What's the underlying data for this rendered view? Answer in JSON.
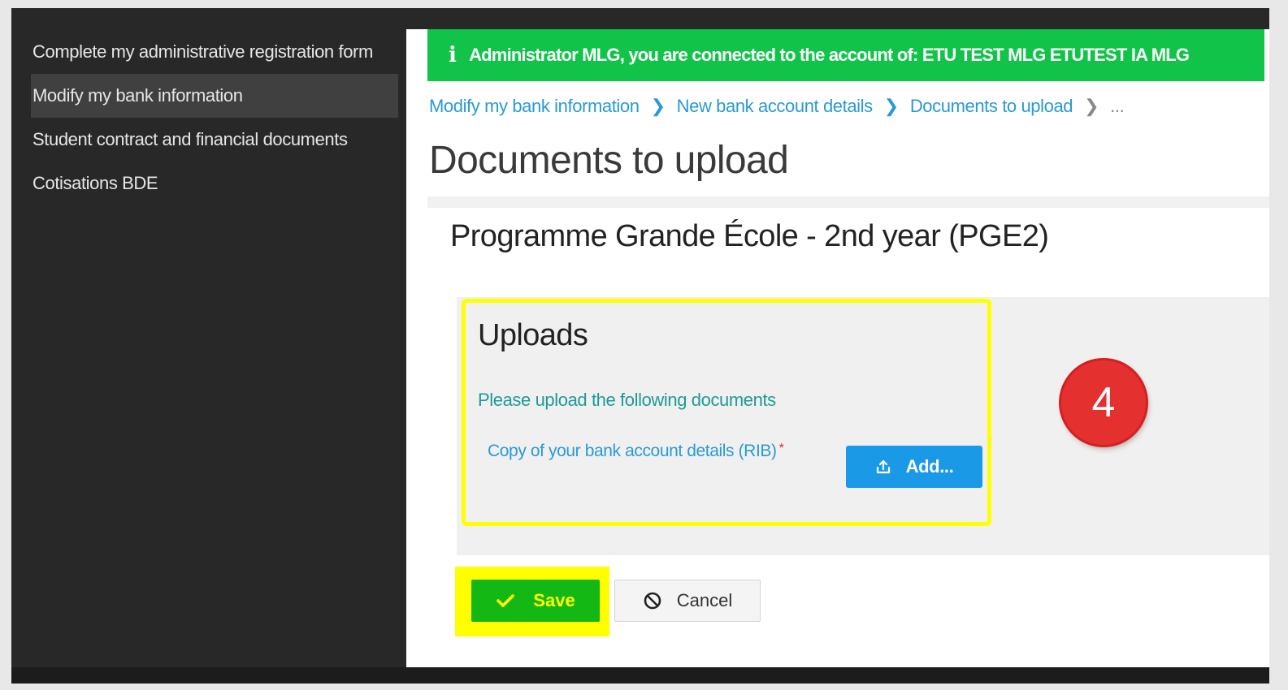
{
  "sidebar": {
    "items": [
      {
        "label": "Complete my administrative registration form"
      },
      {
        "label": "Modify my bank information",
        "active": true
      },
      {
        "label": "Student contract and financial documents"
      },
      {
        "label": "Cotisations BDE"
      }
    ]
  },
  "banner": {
    "icon": "info-icon",
    "text": "Administrator MLG, you are connected to the account of: ETU TEST MLG ETUTEST IA MLG",
    "color": "#11c449"
  },
  "breadcrumb": {
    "items": [
      "Modify my bank information",
      "New bank account details",
      "Documents to upload"
    ],
    "more": "..."
  },
  "page": {
    "title": "Documents to upload",
    "programme": "Programme Grande École - 2nd year (PGE2)"
  },
  "uploads": {
    "title": "Uploads",
    "subtitle": "Please upload the following documents",
    "document_label": "Copy of your bank account details (RIB)",
    "required_marker": "*",
    "add_label": "Add..."
  },
  "step_badge": "4",
  "actions": {
    "save_label": "Save",
    "cancel_label": "Cancel"
  },
  "colors": {
    "accent": "#1a9ae6",
    "save": "#14b814",
    "highlight": "#ffff00",
    "link": "#2a9ad4"
  }
}
